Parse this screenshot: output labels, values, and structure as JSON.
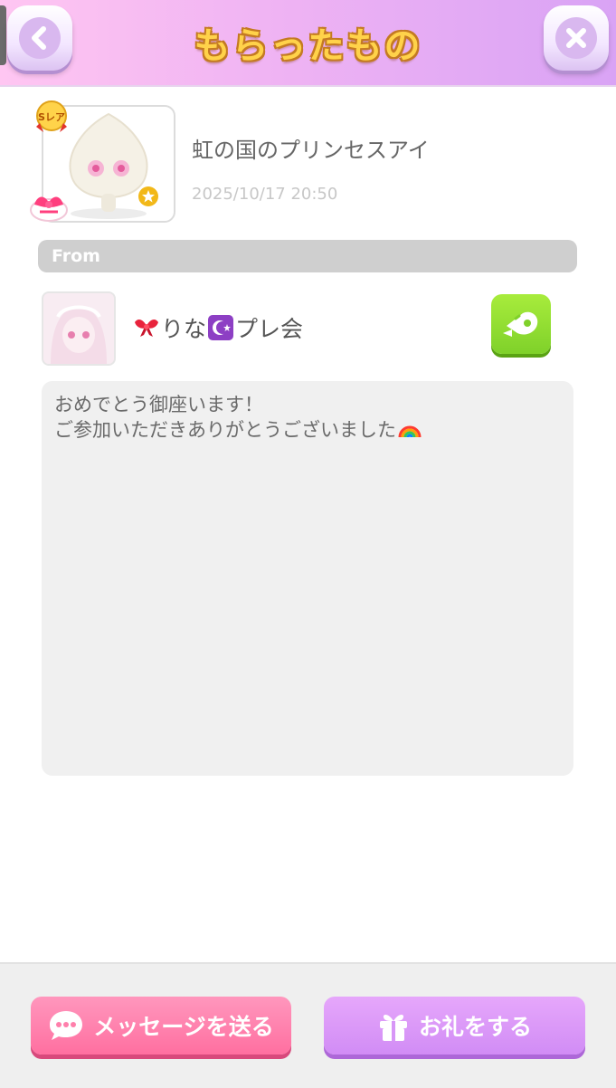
{
  "header": {
    "title": "もらったもの",
    "back_icon": "chevron-left-icon",
    "close_icon": "close-icon",
    "colors": {
      "gradient_start": "#ffc6f2",
      "gradient_end": "#d9a3f5",
      "title": "#ffd24a"
    }
  },
  "item": {
    "rarity_label": "Sレア",
    "name": "虹の国のプリンセスアイ",
    "date": "2025/10/17 20:50"
  },
  "from": {
    "label": "From",
    "sender_prefix_emoji": "🎀",
    "sender_name_part1": "りな",
    "sender_mid_emoji": "☪",
    "sender_name_part2": "プレ会",
    "profile_button_icon": "profile-tag-icon"
  },
  "message": {
    "line1": "おめでとう御座います！",
    "line2": "ご参加いただきありがとうございました"
  },
  "footer": {
    "send_message_label": "メッセージを送る",
    "thank_label": "お礼をする",
    "colors": {
      "message_button": "#ff7fab",
      "gift_button": "#d796f7"
    }
  }
}
